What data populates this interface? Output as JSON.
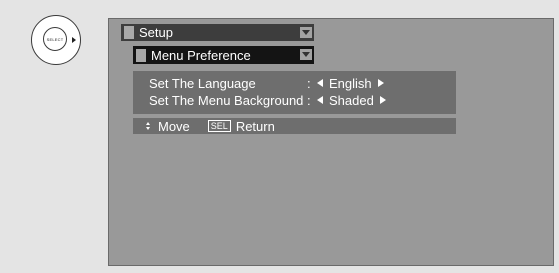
{
  "remote": {
    "center_label": "SELECT",
    "arrow_icon": "right-arrow-icon"
  },
  "menu": {
    "title": "Setup",
    "submenu_title": "Menu Preference",
    "settings": [
      {
        "label": "Set The Language",
        "separator": ":",
        "value": "English"
      },
      {
        "label": "Set The Menu Background",
        "separator": ":",
        "value": "Shaded"
      }
    ]
  },
  "help": {
    "move_label": "Move",
    "sel_key": "SEL",
    "return_label": "Return"
  },
  "colors": {
    "screen_bg": "#999999",
    "panel_bg": "#6e6e6e",
    "header_dark": "#141414",
    "header": "#3d3d3d"
  }
}
